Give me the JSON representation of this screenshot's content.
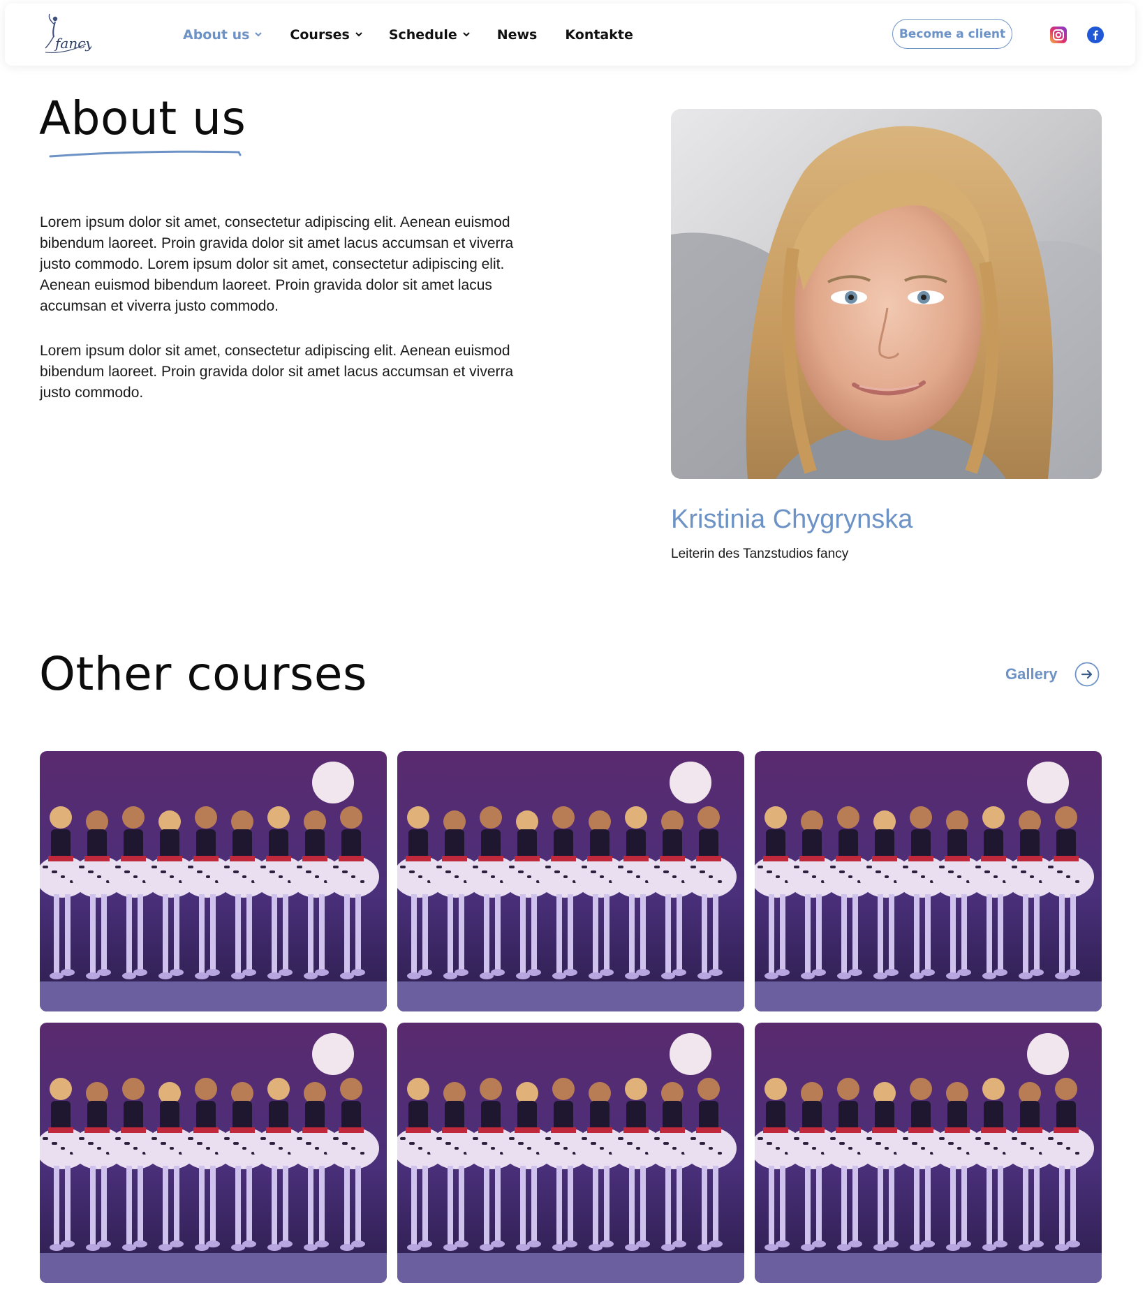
{
  "brand": {
    "logo_text": "fancy"
  },
  "nav": {
    "items": [
      {
        "label": "About us",
        "active": true,
        "has_dropdown": true
      },
      {
        "label": "Courses",
        "active": false,
        "has_dropdown": true
      },
      {
        "label": "Schedule",
        "active": false,
        "has_dropdown": true
      },
      {
        "label": "News",
        "active": false,
        "has_dropdown": false
      },
      {
        "label": "Kontakte",
        "active": false,
        "has_dropdown": false
      }
    ],
    "cta_label": "Become a client",
    "social": [
      {
        "icon": "instagram-icon"
      },
      {
        "icon": "facebook-icon"
      }
    ]
  },
  "about": {
    "title": "About us",
    "paragraphs": [
      "Lorem ipsum dolor sit amet, consectetur adipiscing elit. Aenean euismod bibendum laoreet. Proin gravida dolor sit amet lacus accumsan et viverra justo commodo. Lorem ipsum dolor sit amet, consectetur adipiscing elit. Aenean euismod bibendum laoreet. Proin gravida dolor sit amet lacus accumsan et viverra justo commodo.",
      "Lorem ipsum dolor sit amet, consectetur adipiscing elit. Aenean euismod bibendum laoreet. Proin gravida dolor sit amet lacus accumsan et viverra justo commodo."
    ],
    "person": {
      "name": "Kristinia Chygrynska",
      "role": "Leiterin des Tanzstudios fancy"
    }
  },
  "other_courses": {
    "title": "Other courses",
    "gallery_label": "Gallery",
    "cards": [
      {
        "image": "dance-performance-photo"
      },
      {
        "image": "dance-performance-photo"
      },
      {
        "image": "dance-performance-photo"
      },
      {
        "image": "dance-performance-photo"
      },
      {
        "image": "dance-performance-photo"
      },
      {
        "image": "dance-performance-photo"
      }
    ]
  },
  "colors": {
    "accent": "#6d93c6",
    "text": "#111111",
    "background": "#ffffff"
  }
}
